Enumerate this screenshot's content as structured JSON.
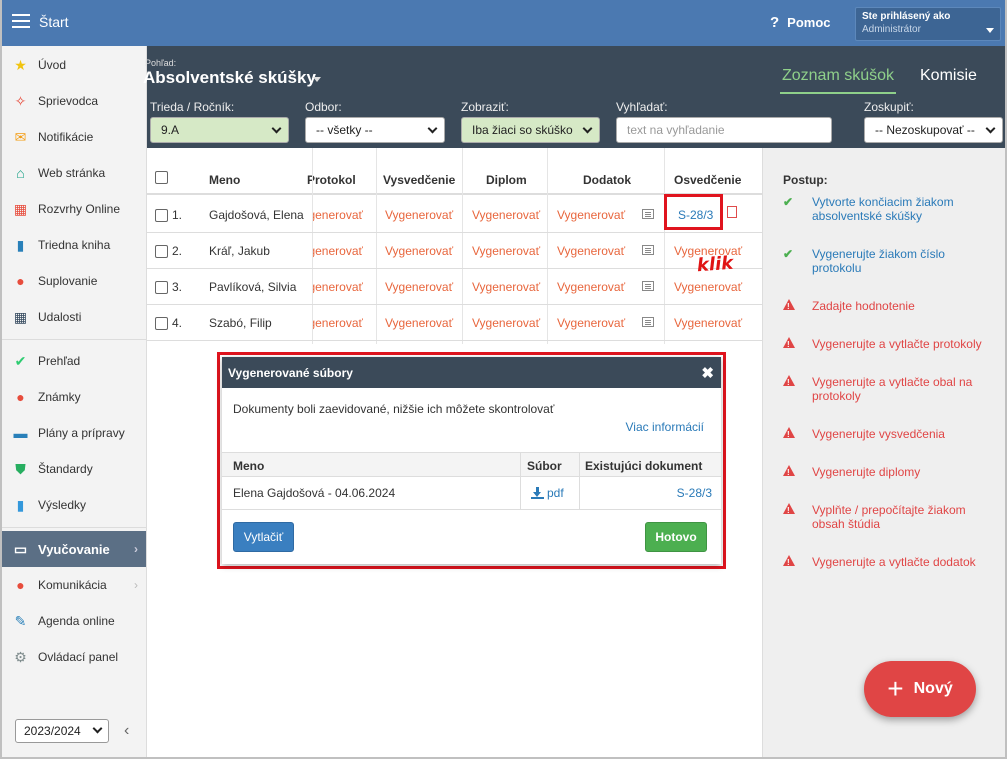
{
  "app": {
    "title": "Štart",
    "help": "Pomoc"
  },
  "login": {
    "line1": "Ste prihlásený ako",
    "line2": "Administrátor"
  },
  "sidebar": {
    "items": [
      {
        "label": "Úvod",
        "icon": "star-icon",
        "glyph": "★",
        "color": "#f1c40f"
      },
      {
        "label": "Sprievodca",
        "icon": "wand-icon",
        "glyph": "✧",
        "color": "#e74c3c"
      },
      {
        "label": "Notifikácie",
        "icon": "envelope-icon",
        "glyph": "✉",
        "color": "#f39c12"
      },
      {
        "label": "Web stránka",
        "icon": "home-icon",
        "glyph": "⌂",
        "color": "#16a085"
      },
      {
        "label": "Rozvrhy Online",
        "icon": "calendar-grid-icon",
        "glyph": "▦",
        "color": "#e74c3c"
      },
      {
        "label": "Triedna kniha",
        "icon": "book-icon",
        "glyph": "▮",
        "color": "#2980b9"
      },
      {
        "label": "Suplovanie",
        "icon": "person-icon",
        "glyph": "●",
        "color": "#e74c3c"
      },
      {
        "label": "Udalosti",
        "icon": "calendar-icon",
        "glyph": "▦",
        "color": "#34495e"
      },
      {
        "label": "Prehľad",
        "icon": "check-circle-icon",
        "glyph": "✔",
        "color": "#2ecc71"
      },
      {
        "label": "Známky",
        "icon": "grade-icon",
        "glyph": "●",
        "color": "#e74c3c"
      },
      {
        "label": "Plány a prípravy",
        "icon": "briefcase-icon",
        "glyph": "▬",
        "color": "#2980b9"
      },
      {
        "label": "Štandardy",
        "icon": "shield-icon",
        "glyph": "⛊",
        "color": "#27ae60"
      },
      {
        "label": "Výsledky",
        "icon": "bar-chart-icon",
        "glyph": "▮",
        "color": "#3498db"
      },
      {
        "label": "Vyučovanie",
        "icon": "book-open-icon",
        "glyph": "▭",
        "color": "#ffffff"
      },
      {
        "label": "Komunikácia",
        "icon": "chat-icon",
        "glyph": "●",
        "color": "#e74c3c"
      },
      {
        "label": "Agenda online",
        "icon": "pen-icon",
        "glyph": "✎",
        "color": "#2980b9"
      },
      {
        "label": "Ovládací panel",
        "icon": "gear-icon",
        "glyph": "⚙",
        "color": "#7f8c8d"
      }
    ],
    "year": "2023/2024"
  },
  "header": {
    "view_label": "Pohľad:",
    "view_title": "Absolventské skúšky",
    "tab_list": "Zoznam skúšok",
    "tab_commissions": "Komisie",
    "filters": {
      "class_label": "Trieda / Ročník:",
      "class_value": "9.A",
      "field_label": "Odbor:",
      "field_value": "-- všetky --",
      "show_label": "Zobraziť:",
      "show_value": "Iba žiaci so skúško",
      "search_label": "Vyhľadať:",
      "search_placeholder": "text na vyhľadanie",
      "group_label": "Zoskupiť:",
      "group_value": "-- Nezoskupovať --"
    }
  },
  "table": {
    "columns": {
      "name": "Meno",
      "protocol": "Protokol",
      "report": "Vysvedčenie",
      "diploma": "Diplom",
      "supplement": "Dodatok",
      "certificate": "Osvedčenie"
    },
    "generate": "Vygenerovať",
    "rows": [
      {
        "num": "1.",
        "name": "Gajdošová, Elena",
        "certificate": "S-28/3"
      },
      {
        "num": "2.",
        "name": "Kráľ, Jakub",
        "certificate": "Vygenerovať"
      },
      {
        "num": "3.",
        "name": "Pavlíková, Silvia",
        "certificate": "Vygenerovať"
      },
      {
        "num": "4.",
        "name": "Szabó, Filip",
        "certificate": "Vygenerovať"
      }
    ]
  },
  "annotation": {
    "klik": "klik"
  },
  "modal": {
    "title": "Vygenerované súbory",
    "text": "Dokumenty boli zaevidované, nižšie ich môžete skontrolovať",
    "more_info": "Viac informácií",
    "col_name": "Meno",
    "col_file": "Súbor",
    "col_existing": "Existujúci dokument",
    "row": {
      "name": "Elena Gajdošová - 04.06.2024",
      "file": "pdf",
      "existing": "S-28/3"
    },
    "print_btn": "Vytlačiť",
    "done_btn": "Hotovo"
  },
  "panel": {
    "title": "Postup:",
    "steps": [
      {
        "text": "Vytvorte končiacim žiakom absolventské skúšky",
        "done": true
      },
      {
        "text": "Vygenerujte žiakom číslo protokolu",
        "done": true
      },
      {
        "text": "Zadajte hodnotenie",
        "done": false
      },
      {
        "text": "Vygenerujte a vytlačte protokoly",
        "done": false
      },
      {
        "text": "Vygenerujte a vytlačte obal na protokoly",
        "done": false
      },
      {
        "text": "Vygenerujte vysvedčenia",
        "done": false
      },
      {
        "text": "Vygenerujte diplomy",
        "done": false
      },
      {
        "text": "Vyplňte / prepočítajte žiakom obsah štúdia",
        "done": false
      },
      {
        "text": "Vygenerujte a vytlačte dodatok",
        "done": false
      }
    ]
  },
  "fab": {
    "label": "Nový"
  }
}
